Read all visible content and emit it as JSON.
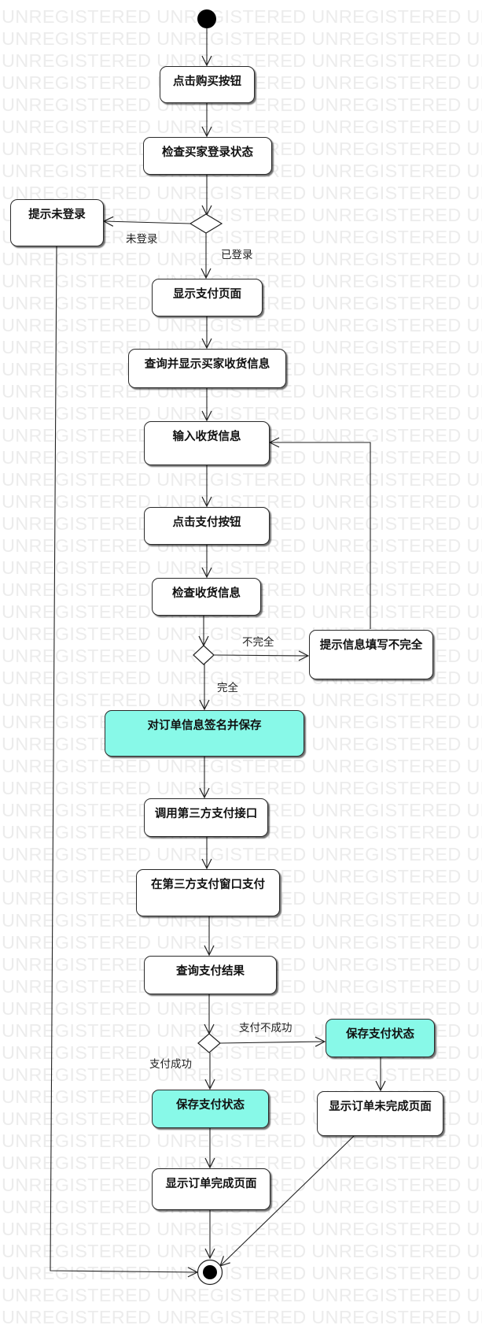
{
  "watermark_text": "UNREGISTERED UNREGISTERED UNREGISTERED UNREGISTERED",
  "colors": {
    "highlight": "#88f9e8",
    "border": "#2a2a2a",
    "watermark": "#ececec"
  },
  "nodes": {
    "click_buy": "点击购买按钮",
    "check_login": "检查买家登录状态",
    "prompt_not_logged": "提示未登录",
    "show_pay_page": "显示支付页面",
    "query_buyer_info": "查询并显示买家收货信息",
    "input_shipping": "输入收货信息",
    "click_pay": "点击支付按钮",
    "check_shipping": "检查收货信息",
    "prompt_incomplete": "提示信息填写不完全",
    "sign_save_order": "对订单信息签名并保存",
    "call_third_party": "调用第三方支付接口",
    "pay_third_party": "在第三方支付窗口支付",
    "query_pay_result": "查询支付结果",
    "save_status_fail": "保存支付状态",
    "save_status_success": "保存支付状态",
    "show_incomplete_page": "显示订单未完成页面",
    "show_complete_page": "显示订单完成页面"
  },
  "edge_labels": {
    "not_logged_in": "未登录",
    "logged_in": "已登录",
    "incomplete": "不完全",
    "complete": "完全",
    "pay_failed": "支付不成功",
    "pay_success": "支付成功"
  }
}
